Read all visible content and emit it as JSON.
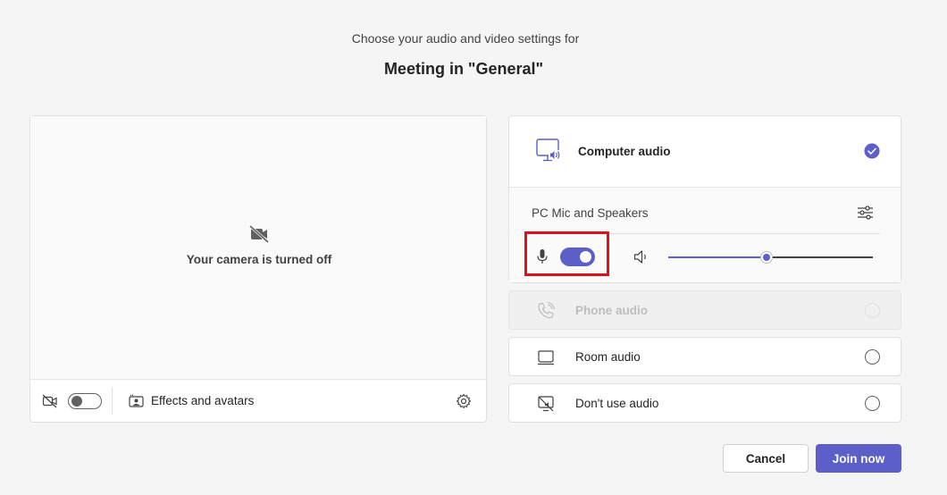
{
  "header": {
    "subtitle": "Choose your audio and video settings for",
    "title": "Meeting in \"General\""
  },
  "camera": {
    "off_message": "Your camera is turned off",
    "camera_toggle_on": false,
    "effects_label": "Effects and avatars",
    "icons": {
      "preview": "camera-off-icon",
      "toolbar_camera": "camera-off-icon",
      "effects": "effects-avatar-icon",
      "settings": "gear-icon"
    }
  },
  "audio": {
    "computer_audio": {
      "label": "Computer audio",
      "selected": true,
      "device_label": "PC Mic and Speakers",
      "mic_on": true,
      "volume_percent": 48,
      "icons": {
        "main": "monitor-speaker-icon",
        "selected": "checkmark-circle-icon",
        "device_settings": "sliders-icon",
        "mic": "microphone-icon",
        "speaker": "speaker-icon"
      }
    },
    "options": [
      {
        "label": "Phone audio",
        "disabled": true,
        "selected": false,
        "icon": "phone-icon"
      },
      {
        "label": "Room audio",
        "disabled": false,
        "selected": false,
        "icon": "room-device-icon"
      },
      {
        "label": "Don't use audio",
        "disabled": false,
        "selected": false,
        "icon": "no-audio-icon"
      }
    ]
  },
  "actions": {
    "cancel_label": "Cancel",
    "join_label": "Join now"
  },
  "colors": {
    "accent": "#5b5fc7",
    "highlight": "#e0101a"
  }
}
